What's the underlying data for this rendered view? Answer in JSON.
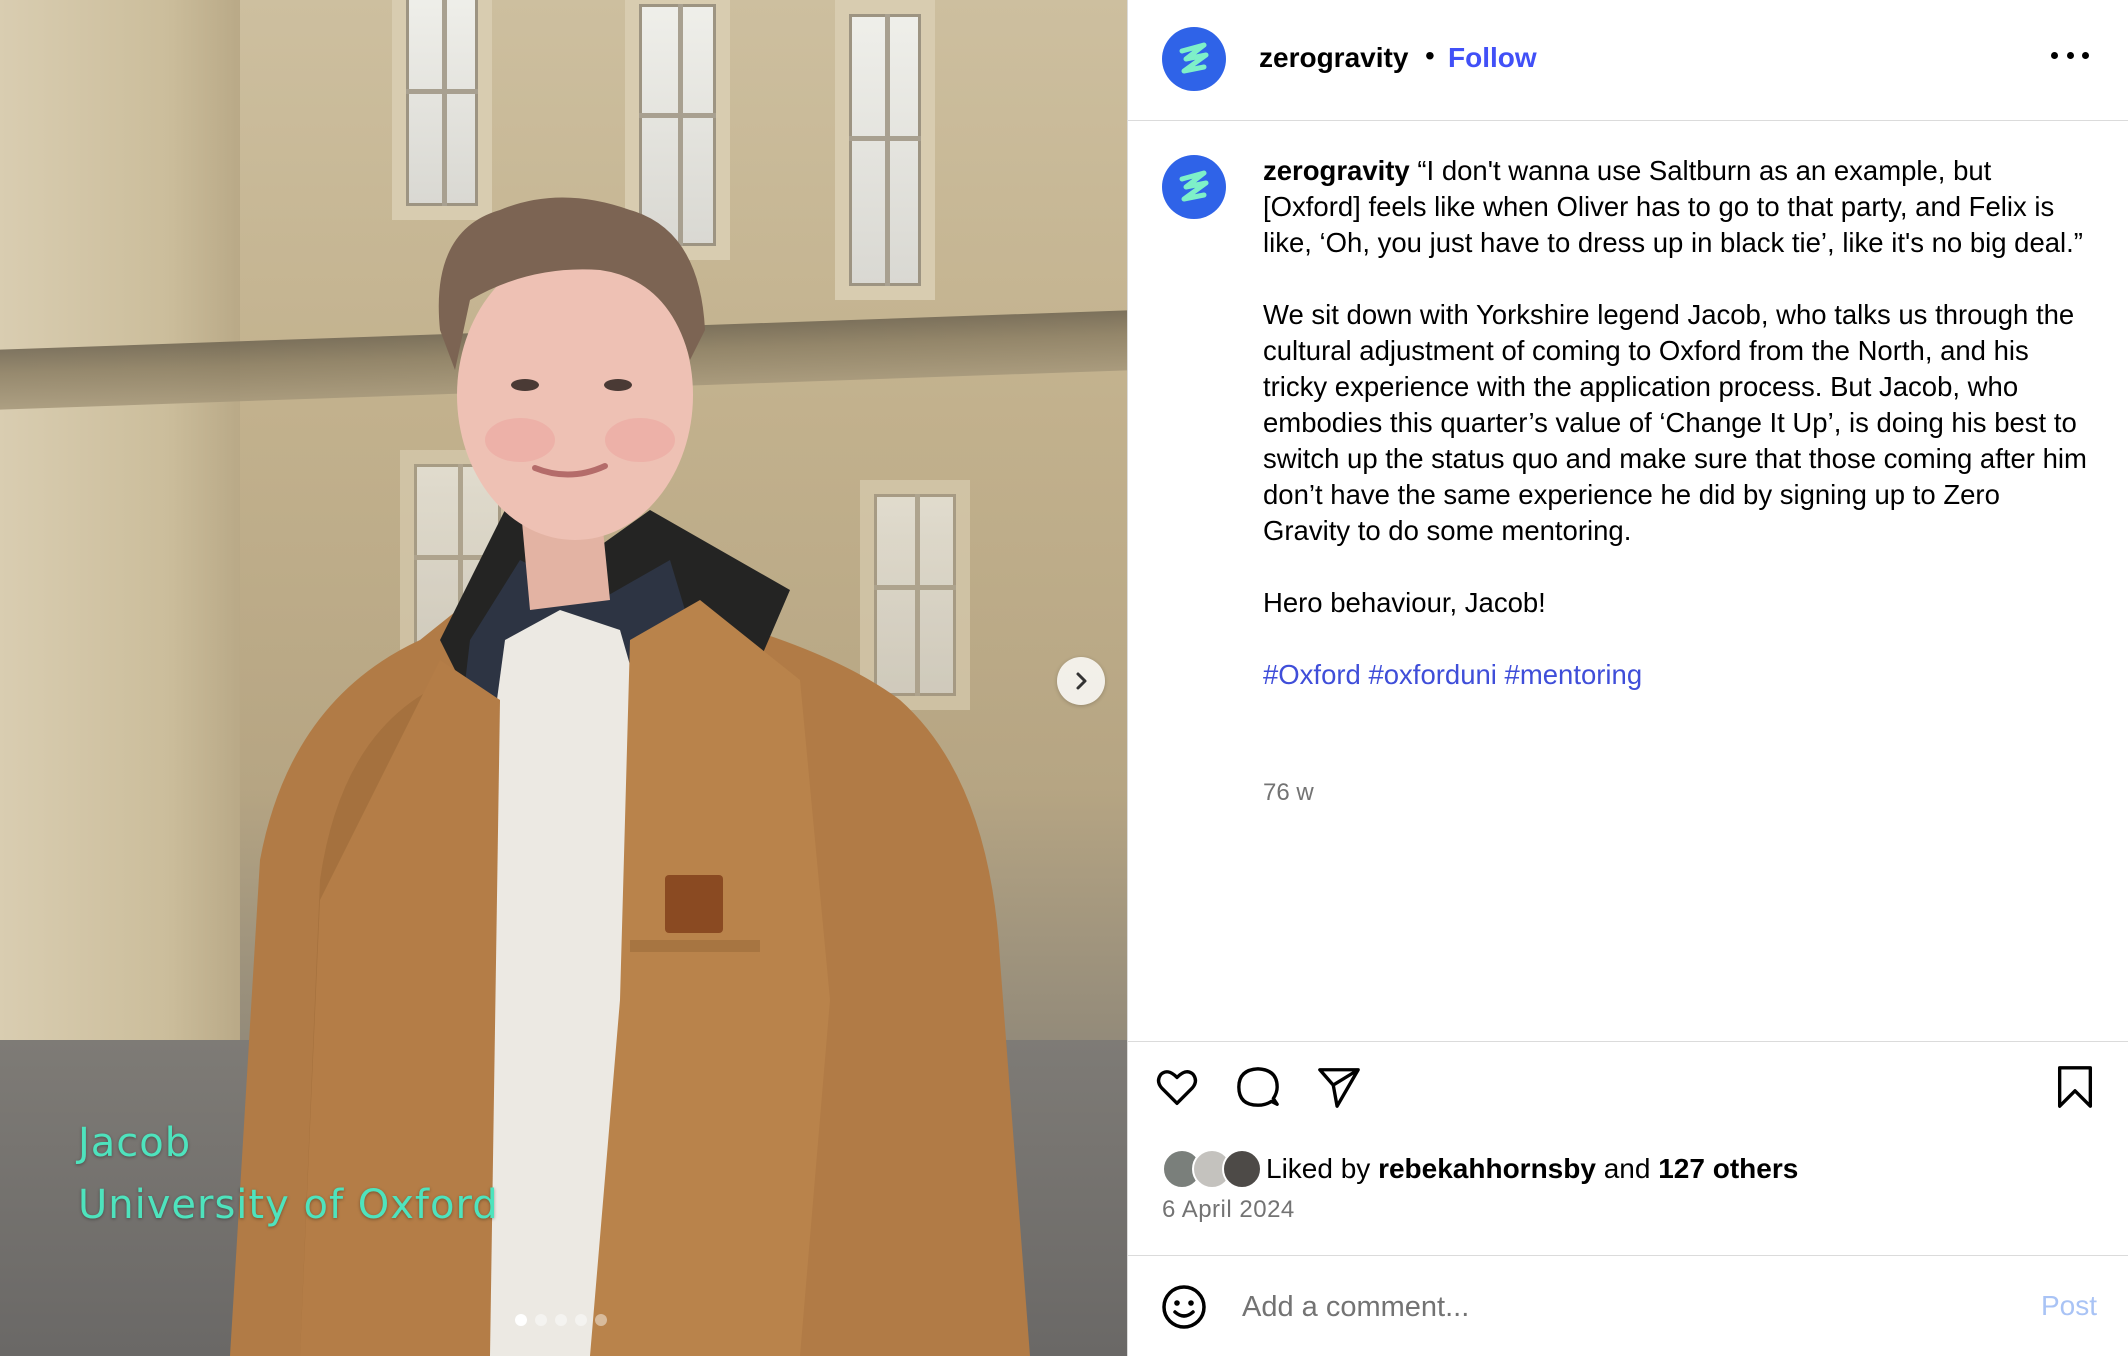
{
  "photo": {
    "caption_name": "Jacob",
    "caption_school": "University of Oxford",
    "carousel": {
      "slide_count": 5,
      "active_index": 0
    }
  },
  "header": {
    "username": "zerogravity",
    "separator": "•",
    "follow_label": "Follow"
  },
  "post": {
    "username": "zerogravity",
    "quote": "“I don't wanna use Saltburn as an example, but [Oxford] feels like when Oliver has to go to that party, and Felix is like, ‘Oh, you just have to dress up in black tie’, like it's no big deal.”",
    "paragraph_1": "We sit down with Yorkshire legend Jacob, who talks us through the cultural adjustment of coming to Oxford from the North, and his tricky experience with the application process. But Jacob, who embodies this quarter’s value of ‘Change It Up’, is doing his best to switch up the status quo and make sure that those coming after him don’t have the same experience he did by signing up to Zero Gravity to do some mentoring.",
    "paragraph_2": "Hero behaviour, Jacob!",
    "hashtags": [
      "#Oxford",
      "#oxforduni",
      "#mentoring"
    ],
    "time_ago": "76 w"
  },
  "engagement": {
    "liked_by_prefix": "Liked by",
    "liked_by_user": "rebekahhornsby",
    "and_word": "and",
    "others": "127 others",
    "date": "6 April 2024"
  },
  "comment": {
    "placeholder": "Add a comment...",
    "post_label": "Post"
  },
  "colors": {
    "accent": "#4150f7",
    "avatar_bg": "#2f63e8",
    "caption_overlay": "#4ee3bd",
    "post_disabled": "#a9c3f5"
  },
  "icons": {
    "avatar": "zero-gravity-logo-icon",
    "like": "heart-icon",
    "comment": "comment-bubble-icon",
    "share": "paper-plane-icon",
    "save": "bookmark-icon",
    "emoji": "smiley-icon",
    "next": "chevron-right-icon",
    "more": "more-options-icon"
  }
}
